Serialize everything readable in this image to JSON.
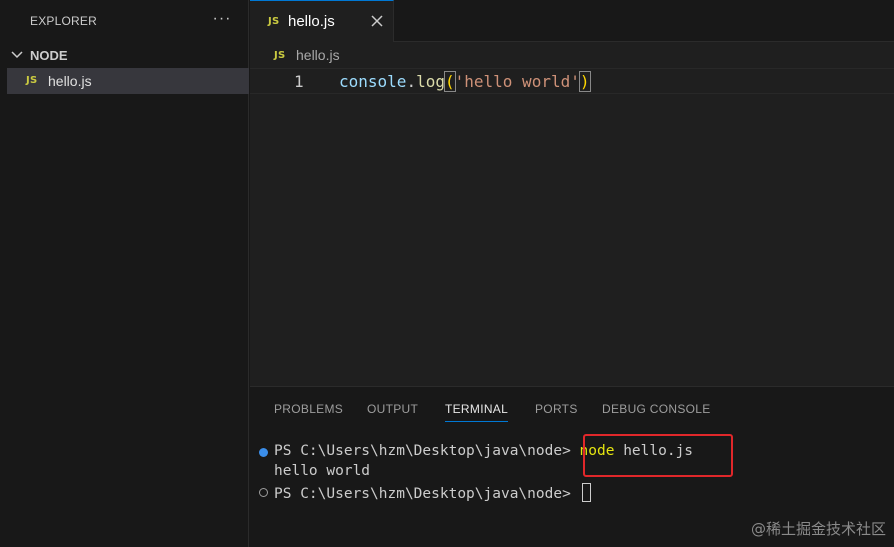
{
  "explorer": {
    "title": "EXPLORER",
    "more_label": "···",
    "folder": "NODE",
    "files": [
      {
        "badge": "JS",
        "name": "hello.js"
      }
    ]
  },
  "editor": {
    "tab": {
      "badge": "JS",
      "label": "hello.js"
    },
    "breadcrumb": {
      "badge": "JS",
      "label": "hello.js"
    },
    "line_number": "1",
    "code": {
      "object": "console",
      "dot": ".",
      "method": "log",
      "open_paren": "(",
      "string": "'hello world'",
      "close_paren": ")"
    }
  },
  "panel": {
    "tabs": [
      "PROBLEMS",
      "OUTPUT",
      "TERMINAL",
      "PORTS",
      "DEBUG CONSOLE"
    ],
    "active_tab": "TERMINAL",
    "terminal": {
      "prompt1": "PS C:\\Users\\hzm\\Desktop\\java\\node>",
      "cmd": "node",
      "cmd_arg": "hello.js",
      "output": "hello world",
      "prompt2": "PS C:\\Users\\hzm\\Desktop\\java\\node>"
    }
  },
  "watermark": "@稀土掘金技术社区",
  "colors": {
    "accent": "#0078d4",
    "js_badge": "#cbcb41",
    "highlight_box": "#e0272a",
    "string": "#ce9178",
    "function": "#dcdcaa",
    "variable": "#9cdcfe"
  }
}
